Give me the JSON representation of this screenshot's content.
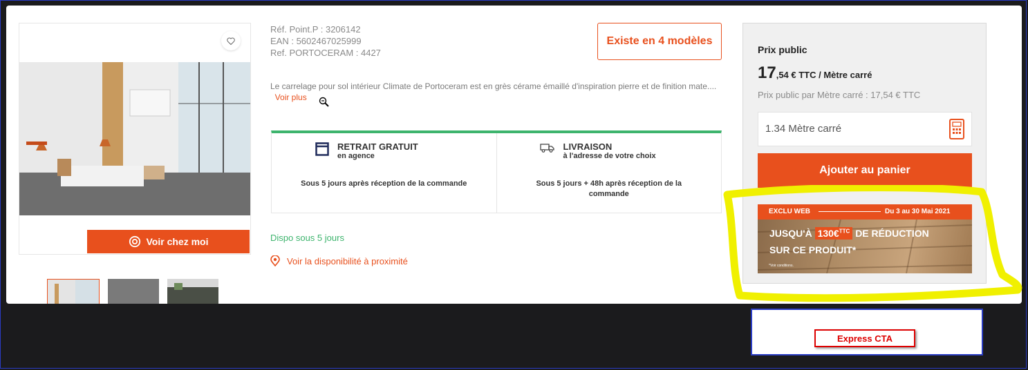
{
  "product": {
    "ref_point_p": "Réf. Point.P : 3206142",
    "ean": "EAN : 5602467025999",
    "ref_portoceram": "Ref. PORTOCERAM : 4427",
    "models_button": "Existe en 4 modèles",
    "description": "Le carrelage pour sol intérieur Climate de Portoceram est en grès cérame émaillé d'inspiration pierre et de finition mate....",
    "voir_plus": "Voir plus",
    "voir_chez_moi": "Voir chez moi"
  },
  "delivery": {
    "pickup": {
      "title": "RETRAIT GRATUIT",
      "subtitle": "en agence",
      "text": "Sous 5 jours après réception de la commande",
      "icon": "store-icon"
    },
    "shipping": {
      "title": "LIVRAISON",
      "subtitle": "à l'adresse de votre choix",
      "text": "Sous 5 jours + 48h après réception de la commande",
      "icon": "truck-icon"
    }
  },
  "availability": {
    "dispo": "Dispo sous 5 jours",
    "nearby": "Voir la disponibilité à proximité"
  },
  "price_panel": {
    "title": "Prix public",
    "price_int": "17",
    "price_rest": ",54 € TTC / Mètre carré",
    "unit_price": "Prix public par Mètre carré : 17,54 € TTC",
    "quantity": "1.34 Mètre carré",
    "add_to_cart": "Ajouter au panier"
  },
  "promo": {
    "tag": "EXCLU WEB",
    "dates": "Du 3 au 30 Mai 2021",
    "line1_pre": "JUSQU'À",
    "amount": "130€",
    "amount_sup": "TTC",
    "line1_post": "DE RÉDUCTION",
    "line2": "SUR CE PRODUIT*",
    "note": "*Voir conditions."
  },
  "footer": {
    "express_cta": "Express CTA"
  },
  "colors": {
    "accent": "#e8501d",
    "success": "#3db46d",
    "highlight": "#f0f000",
    "frame": "#2a3cc4"
  }
}
